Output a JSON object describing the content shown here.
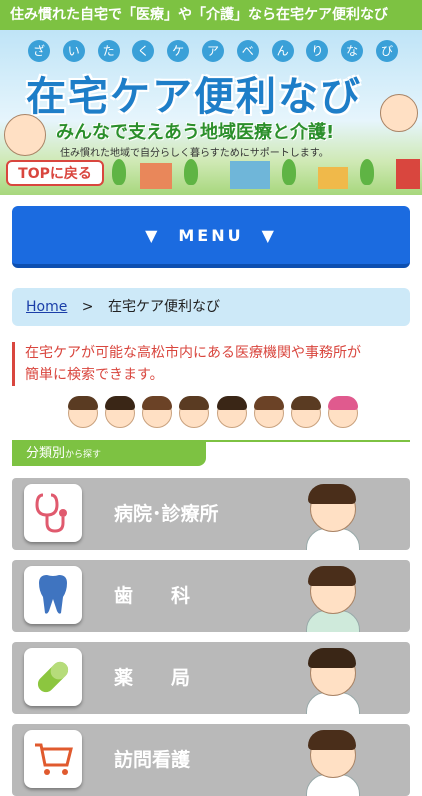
{
  "topbar": {
    "text": "住み慣れた自宅で「医療」や「介護」なら在宅ケア便利なび"
  },
  "banner": {
    "kana": [
      "ざ",
      "い",
      "た",
      "く",
      "ケ",
      "ア",
      "べ",
      "ん",
      "り",
      "な",
      "び"
    ],
    "title": "在宅ケア便利なび",
    "subtitle": "みんなで支えあう地域医療と介護!",
    "tagline": "住み慣れた地域で自分らしく暮らすためにサポートします。",
    "top_button": "TOPに戻る"
  },
  "menu": {
    "label": "MENU",
    "arrow": "▼"
  },
  "breadcrumb": {
    "home": "Home",
    "separator": ">",
    "current": "在宅ケア便利なび"
  },
  "intro": {
    "line1": "在宅ケアが可能な高松市内にある医療機関や事務所が",
    "line2": "簡単に検索できます。"
  },
  "section": {
    "title": "分類別",
    "suffix": "から探す"
  },
  "categories": [
    {
      "label": "病院･診療所",
      "icon": "stethoscope-icon",
      "color": "#e05a6e"
    },
    {
      "label": "歯　　科",
      "icon": "tooth-icon",
      "color": "#3f74c0"
    },
    {
      "label": "薬　　局",
      "icon": "pill-icon",
      "color": "#8cc63f"
    },
    {
      "label": "訪問看護",
      "icon": "cart-icon",
      "color": "#e05a2e"
    }
  ],
  "colors": {
    "green": "#7dc242",
    "blue": "#1b6be0",
    "red": "#d9463e",
    "light_blue": "#cde9f8",
    "gray": "#b9b9b9"
  }
}
